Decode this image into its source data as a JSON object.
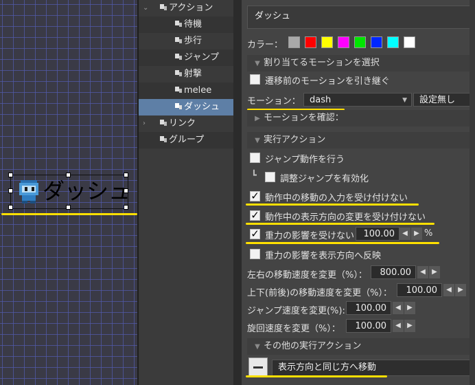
{
  "canvas": {
    "object_label": "ダッシュ"
  },
  "tree": {
    "items": [
      {
        "label": "アクション",
        "expanded": true
      },
      {
        "label": "待機"
      },
      {
        "label": "歩行"
      },
      {
        "label": "ジャンプ"
      },
      {
        "label": "射撃"
      },
      {
        "label": "melee"
      },
      {
        "label": "ダッシュ",
        "selected": true
      },
      {
        "label": "リンク",
        "expanded": false
      },
      {
        "label": "グループ"
      }
    ]
  },
  "props": {
    "name": "ダッシュ",
    "color_label": "カラー：",
    "colors": [
      "#a9a9a9",
      "#ff0000",
      "#ffff00",
      "#ff00ff",
      "#00e600",
      "#0026ff",
      "#00ffff",
      "#ffffff"
    ],
    "sections": {
      "assign_motion": "割り当てるモーションを選択",
      "confirm_motion": "モーションを確認：",
      "exec_action": "実行アクション",
      "other_exec": "その他の実行アクション"
    },
    "inherit_motion": "遷移前のモーションを引き継ぐ",
    "motion_label": "モーション：",
    "motion_value": "dash",
    "motion_setting": "設定無し",
    "jump_action": "ジャンプ動作を行う",
    "jump_adjust": "調整ジャンプを有効化",
    "ignore_move_input": "動作中の移動の入力を受け付けない",
    "ignore_direction_change": "動作中の表示方向の変更を受け付けない",
    "ignore_gravity": "重力の影響を受けない",
    "gravity_value": "100.00",
    "percent": "%",
    "reverse_gravity": "重力の影響を表示方向へ反映",
    "lr_speed_label": "左右の移動速度を変更（%）：",
    "lr_speed": "800.00",
    "ud_speed_label": "上下(前後)の移動速度を変更（%）：",
    "ud_speed": "100.00",
    "jump_speed_label": "ジャンプ速度を変更(%):",
    "jump_speed": "100.00",
    "turn_speed_label": "旋回速度を変更（%）：",
    "turn_speed": "100.00",
    "other_action_text": "表示方向と同じ方へ移動"
  }
}
